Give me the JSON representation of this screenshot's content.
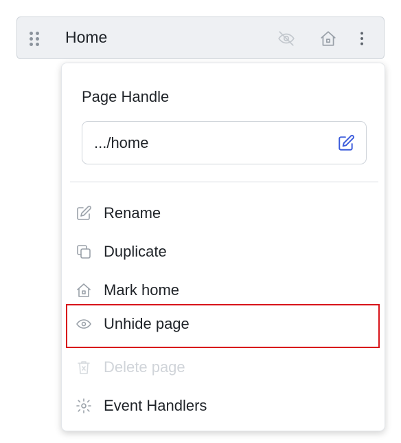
{
  "page_row": {
    "name": "Home",
    "icons": [
      "drag-handle-icon",
      "eye-off-icon",
      "home-icon",
      "more-vertical-icon"
    ]
  },
  "menu": {
    "title": "Page Handle",
    "handle_value": ".../home",
    "items": [
      {
        "label": "Rename",
        "icon": "edit-icon",
        "disabled": false
      },
      {
        "label": "Duplicate",
        "icon": "copy-icon",
        "disabled": false
      },
      {
        "label": "Mark home",
        "icon": "home-icon",
        "disabled": false
      },
      {
        "label": "Unhide page",
        "icon": "eye-icon",
        "disabled": false,
        "highlighted": true
      },
      {
        "label": "Delete page",
        "icon": "trash-icon",
        "disabled": true
      },
      {
        "label": "Event Handlers",
        "icon": "gear-icon",
        "disabled": false
      }
    ]
  },
  "colors": {
    "accent": "#3b5bdb",
    "highlight_border": "#d8141a",
    "icon_gray": "#8b939c",
    "disabled_text": "#d0d4d9"
  }
}
